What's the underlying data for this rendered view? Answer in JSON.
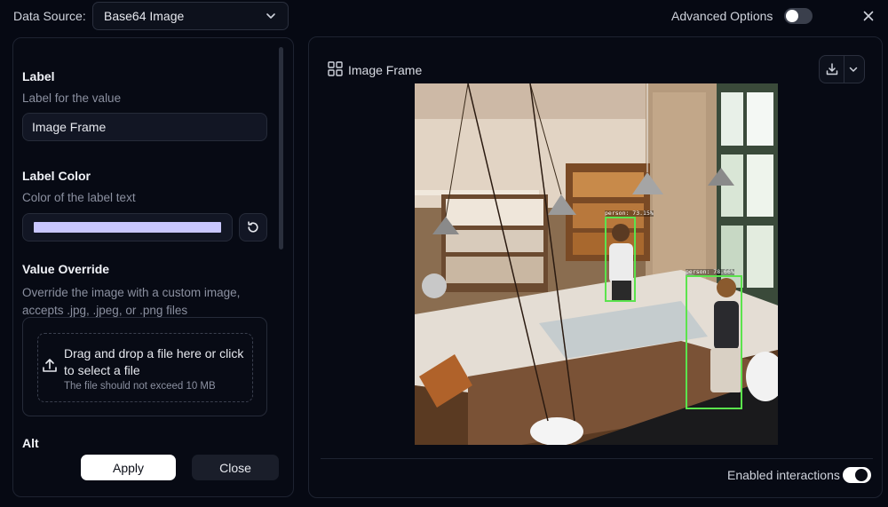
{
  "top_bar": {
    "data_source_label": "Data Source:",
    "data_source_value": "Base64 Image",
    "advanced_options_label": "Advanced Options",
    "advanced_options_enabled": false
  },
  "settings_panel": {
    "label_field": {
      "title": "Label",
      "description": "Label for the value",
      "value": "Image Frame"
    },
    "label_color_field": {
      "title": "Label Color",
      "description": "Color of the label text",
      "color": "#c9c7ff"
    },
    "value_override_field": {
      "title": "Value Override",
      "description": "Override the image with a custom image, accepts .jpg, .jpeg, or .png files",
      "dropzone_text": "Drag and drop a file here or click to select a file",
      "dropzone_note": "The file should not exceed 10 MB"
    },
    "alt_field": {
      "title": "Alt"
    },
    "apply_label": "Apply",
    "close_label": "Close"
  },
  "preview_panel": {
    "title": "Image Frame",
    "enabled_interactions_label": "Enabled interactions",
    "enabled_interactions_on": true,
    "detections": [
      {
        "label": "person: 73.15%"
      },
      {
        "label": "person: 78.66%"
      }
    ]
  },
  "colors": {
    "background": "#060913",
    "detection_box": "#5be34d",
    "accent": "#ffffff"
  }
}
